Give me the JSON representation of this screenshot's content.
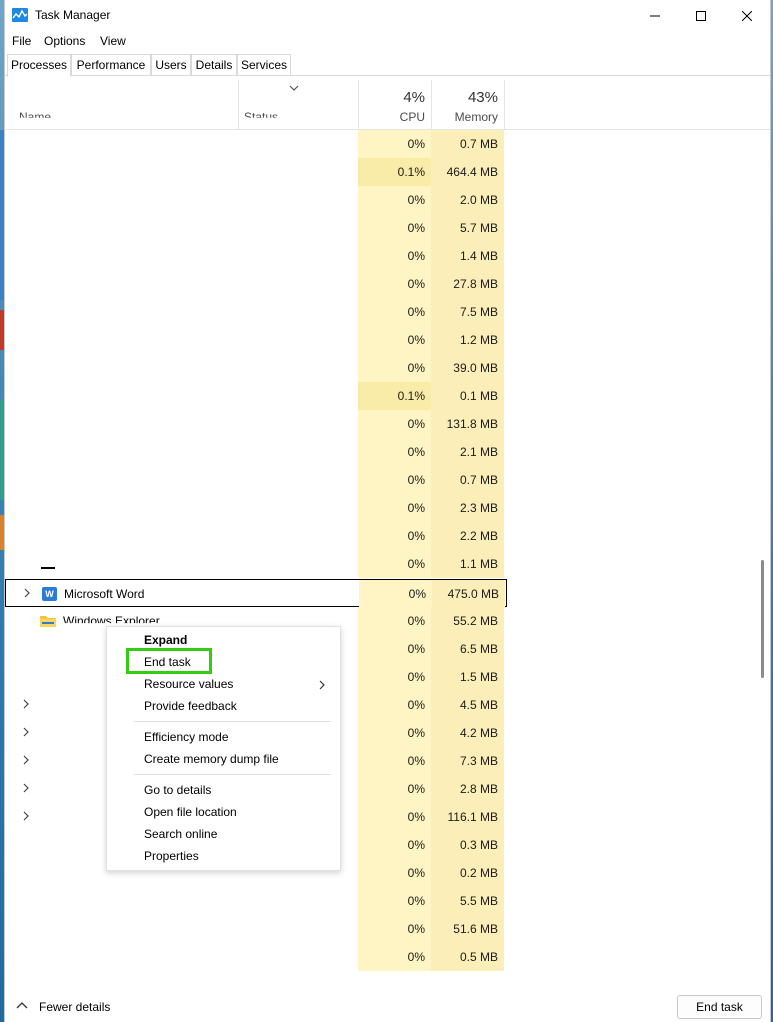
{
  "window": {
    "title": "Task Manager"
  },
  "menu": [
    "File",
    "Options",
    "View"
  ],
  "tabs": [
    "Processes",
    "Performance",
    "Users",
    "Details",
    "Services"
  ],
  "columns": {
    "name": "Name",
    "status": "Status",
    "cpu": {
      "percent": "4%",
      "label": "CPU"
    },
    "memory": {
      "percent": "43%",
      "label": "Memory"
    }
  },
  "rows": [
    {
      "name": "",
      "cpu": "0%",
      "mem": "0.7 MB",
      "hl": false
    },
    {
      "name": "",
      "cpu": "0.1%",
      "mem": "464.4 MB",
      "hl": true
    },
    {
      "name": "",
      "cpu": "0%",
      "mem": "2.0 MB",
      "hl": false
    },
    {
      "name": "",
      "cpu": "0%",
      "mem": "5.7 MB",
      "hl": false
    },
    {
      "name": "",
      "cpu": "0%",
      "mem": "1.4 MB",
      "hl": false
    },
    {
      "name": "",
      "cpu": "0%",
      "mem": "27.8 MB",
      "hl": false
    },
    {
      "name": "",
      "cpu": "0%",
      "mem": "7.5 MB",
      "hl": false
    },
    {
      "name": "",
      "cpu": "0%",
      "mem": "1.2 MB",
      "hl": false
    },
    {
      "name": "",
      "cpu": "0%",
      "mem": "39.0 MB",
      "hl": false
    },
    {
      "name": "",
      "cpu": "0.1%",
      "mem": "0.1 MB",
      "hl": true
    },
    {
      "name": "",
      "cpu": "0%",
      "mem": "131.8 MB",
      "hl": false
    },
    {
      "name": "",
      "cpu": "0%",
      "mem": "2.1 MB",
      "hl": false
    },
    {
      "name": "",
      "cpu": "0%",
      "mem": "0.7 MB",
      "hl": false
    },
    {
      "name": "",
      "cpu": "0%",
      "mem": "2.3 MB",
      "hl": false
    },
    {
      "name": "",
      "cpu": "0%",
      "mem": "2.2 MB",
      "hl": false
    },
    {
      "name": "",
      "cpu": "0%",
      "mem": "1.1 MB",
      "hl": false
    },
    {
      "name": "Microsoft Word",
      "cpu": "0%",
      "mem": "475.0 MB",
      "hl": false,
      "selected": true,
      "icon": "word-icon",
      "expander": true
    },
    {
      "name": "Windows Explorer",
      "cpu": "0%",
      "mem": "55.2 MB",
      "hl": false,
      "icon": "folder-icon"
    },
    {
      "name": "",
      "cpu": "0%",
      "mem": "6.5 MB",
      "hl": false
    },
    {
      "name": "",
      "cpu": "0%",
      "mem": "1.5 MB",
      "hl": false
    },
    {
      "name": "",
      "cpu": "0%",
      "mem": "4.5 MB",
      "hl": false,
      "expander": true
    },
    {
      "name": "",
      "cpu": "0%",
      "mem": "4.2 MB",
      "hl": false,
      "expander": true
    },
    {
      "name": "",
      "cpu": "0%",
      "mem": "7.3 MB",
      "hl": false,
      "expander": true
    },
    {
      "name": "",
      "cpu": "0%",
      "mem": "2.8 MB",
      "hl": false,
      "expander": true
    },
    {
      "name": "",
      "cpu": "0%",
      "mem": "116.1 MB",
      "hl": false,
      "expander": true
    },
    {
      "name": "",
      "cpu": "0%",
      "mem": "0.3 MB",
      "hl": false
    },
    {
      "name": "",
      "cpu": "0%",
      "mem": "0.2 MB",
      "hl": false
    },
    {
      "name": "",
      "cpu": "0%",
      "mem": "5.5 MB",
      "hl": false
    },
    {
      "name": "",
      "cpu": "0%",
      "mem": "51.6 MB",
      "hl": false
    },
    {
      "name": "",
      "cpu": "0%",
      "mem": "0.5 MB",
      "hl": false
    }
  ],
  "context_menu": {
    "items": [
      {
        "label": "Expand",
        "bold": true
      },
      {
        "label": "End task",
        "highlighted": true
      },
      {
        "label": "Resource values",
        "submenu": true
      },
      {
        "label": "Provide feedback"
      },
      {
        "separator": true
      },
      {
        "label": "Efficiency mode"
      },
      {
        "label": "Create memory dump file"
      },
      {
        "separator": true
      },
      {
        "label": "Go to details"
      },
      {
        "label": "Open file location"
      },
      {
        "label": "Search online"
      },
      {
        "label": "Properties"
      }
    ],
    "highlight_color": "#33cc11"
  },
  "footer": {
    "fewer_details": "Fewer details",
    "end_task": "End task"
  },
  "colors": {
    "cpu_bg": "#fff4c4",
    "cpu_bg_hl": "#f9eca8",
    "mem_bg": "#fbeeb8"
  }
}
